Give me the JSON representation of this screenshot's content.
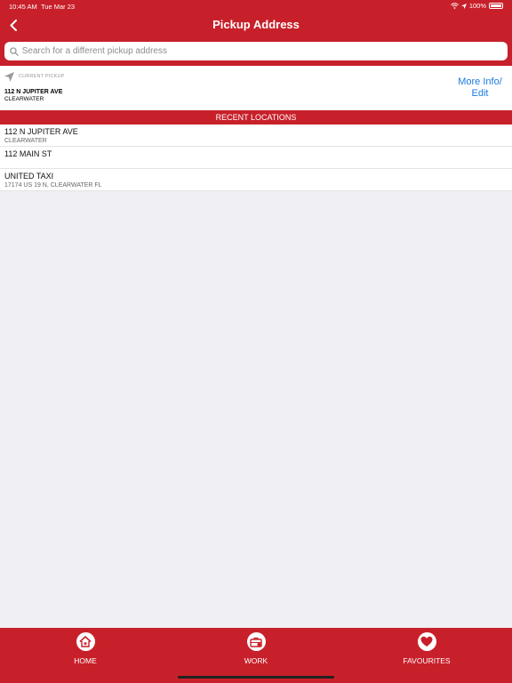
{
  "status_bar": {
    "time": "10:45 AM",
    "date": "Tue Mar 23",
    "battery": "100%"
  },
  "nav": {
    "title": "Pickup Address"
  },
  "search": {
    "placeholder": "Search for a different pickup address"
  },
  "current_pickup": {
    "label": "CURRENT PICKUP",
    "address": "112 N JUPITER AVE",
    "city": "CLEARWATER",
    "more_info_line1": "More Info/",
    "more_info_line2": "Edit"
  },
  "recent": {
    "header": "RECENT LOCATIONS",
    "items": [
      {
        "name": "112 N JUPITER AVE",
        "sub": "CLEARWATER"
      },
      {
        "name": "112 MAIN ST",
        "sub": ""
      },
      {
        "name": "UNITED TAXI",
        "sub": "17174 US 19 N, CLEARWATER  FL"
      }
    ]
  },
  "tabs": [
    {
      "label": "HOME",
      "icon": "home-icon"
    },
    {
      "label": "WORK",
      "icon": "briefcase-icon"
    },
    {
      "label": "FAVOURITES",
      "icon": "heart-icon"
    }
  ],
  "colors": {
    "brand": "#c8202a",
    "link": "#1a7be0"
  }
}
